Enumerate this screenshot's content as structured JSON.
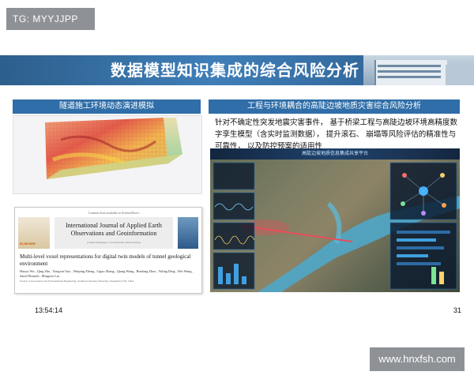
{
  "tag": {
    "text": "TG: MYYJJPP"
  },
  "slide": {
    "title": "数据模型知识集成的综合风险分析",
    "left_panel": {
      "header": "隧道施工环境动态演进模拟",
      "paper": {
        "journal_top_line": "Contents lists available at ScienceDirect",
        "publisher": "ELSEVIER",
        "journal_name": "International Journal of Applied Earth Observations and Geoinformation",
        "journal_homepage": "journal homepage: www.elsevier.com/locate/jag",
        "title": "Multi-level voxel representations for digital twin models of tunnel geological environment",
        "authors": "Haoyu Wu , Qing Zhu , Yongxin Guo , Weiping Zheng , Liguo Zhang , Qiang Wang , Runfang Zhou , Yuling Ding , Wei Wang , Saied Pirasteh , Mingwei Liu",
        "affiliations": "Faculty of Geosciences and Environmental Engineering, Southwest Jiaotong University, Chengdu 611756, China"
      }
    },
    "right_panel": {
      "header": "工程与环境耦合的高陡边坡地质灾害综合风险分析",
      "description": "针对不确定性突发地震灾害事件， 基于桥梁工程与高陡边坡环境高精度数字孪生模型（含实时监测数据）， 提升滚石、 崩塌等风险评估的精准性与可靠性， 以及防控预案的适用性",
      "dashboard_title": "高陡边坡地质信息集成共享平台"
    },
    "footer": {
      "time": "13:54:14",
      "page": "31"
    }
  },
  "watermark": {
    "text": "www.hnxfsh.com"
  }
}
